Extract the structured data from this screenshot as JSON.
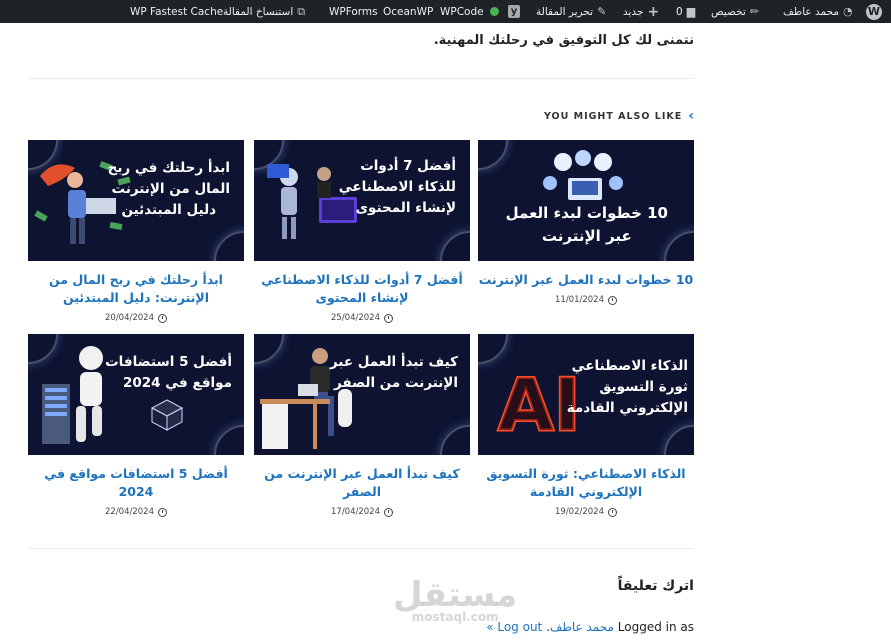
{
  "admin_bar": {
    "wp_fastest_cache": "WP Fastest Cache",
    "duplicate_post": "استنساخ المقالة",
    "wpforms": "WPForms",
    "oceanwp": "OceanWP",
    "wpcode": "WPCode",
    "edit_post": "تحرير المقالة",
    "new": "جديد",
    "comments_count": "0",
    "customize": "تخصيص",
    "user": "محمد عاطف"
  },
  "intro_text": "نتمنى لك كل التوفيق في رحلتك المهنية.",
  "related": {
    "heading": "YOU MIGHT ALSO LIKE",
    "cards": [
      {
        "thumb_lines": [
          "10 خطوات لبدء العمل",
          "عبر الإنترنت"
        ],
        "title": "10 خطوات لبدء العمل عبر الإنترنت",
        "date": "11/01/2024"
      },
      {
        "thumb_lines": [
          "أفضل 7 أدوات",
          "للذكاء الاصطناعي",
          "لإنشاء المحتوى"
        ],
        "title": "أفضل 7 أدوات للذكاء الاصطناعي لإنشاء المحتوى",
        "date": "25/04/2024"
      },
      {
        "thumb_lines": [
          "ابدأ رحلتك في ربح",
          "المال من الإنترنت",
          "دليل المبتدئين"
        ],
        "title": "ابدأ رحلتك في ربح المال من الإنترنت: دليل المبتدئين",
        "date": "20/04/2024"
      },
      {
        "thumb_lines": [
          "الذكاء الاصطناعي",
          "ثورة التسويق",
          "الإلكتروني القادمة"
        ],
        "title": "الذكاء الاصطناعي: ثورة التسويق الإلكتروني القادمة",
        "date": "19/02/2024"
      },
      {
        "thumb_lines": [
          "كيف تبدأ العمل عبر",
          "الإنترنت من الصفر"
        ],
        "title": "كيف تبدأ العمل عبر الإنترنت من الصفر",
        "date": "17/04/2024"
      },
      {
        "thumb_lines": [
          "أفضل 5 استضافات",
          "مواقع في 2024"
        ],
        "title": "أفضل 5 استضافات مواقع في 2024",
        "date": "22/04/2024"
      }
    ]
  },
  "comment": {
    "heading": "اترك تعليقاً",
    "logged_in_as": "Logged in as",
    "user_link": "محمد عاطف",
    "logout": "Log out »"
  },
  "watermark": {
    "arabic": "مستقل",
    "latin": "mostaql.com"
  }
}
